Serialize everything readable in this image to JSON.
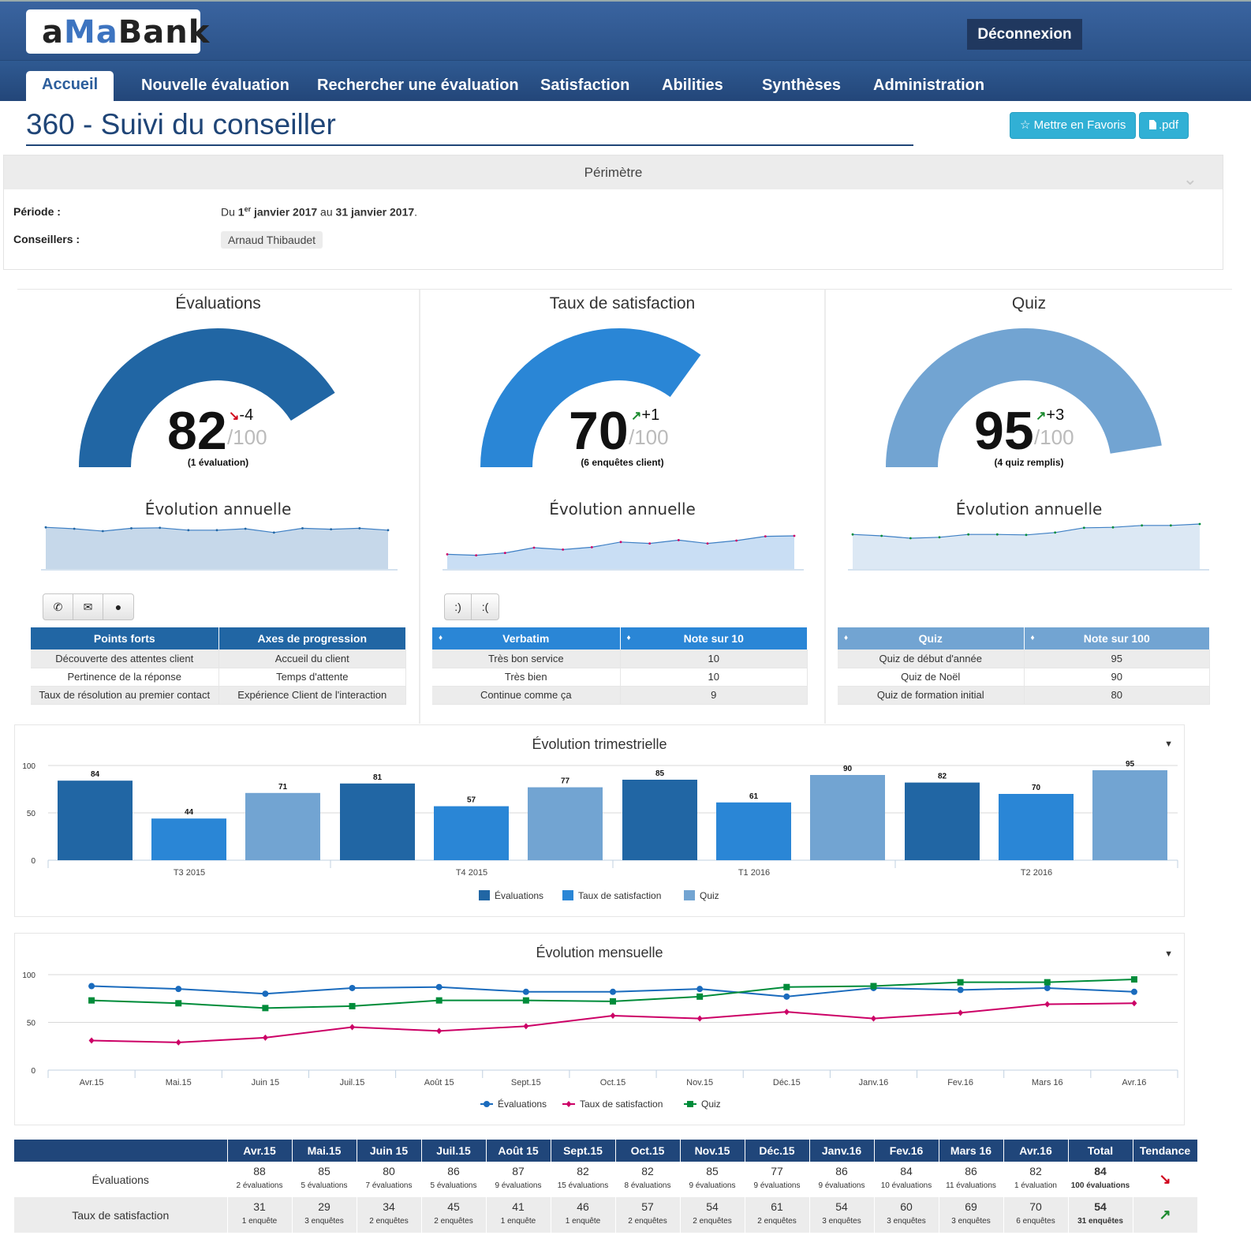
{
  "app": {
    "logo_parts": [
      "a",
      "Ma",
      "Bank"
    ],
    "logout_label": "Déconnexion",
    "brand_colors": {
      "dark": "#2166a4",
      "mid": "#2a86d6",
      "light": "#72a4d2",
      "nav": "#2b5288",
      "pink": "#cc0066",
      "green": "#008c3a"
    }
  },
  "nav": {
    "items": [
      {
        "label": "Accueil",
        "active": true
      },
      {
        "label": "Nouvelle évaluation"
      },
      {
        "label": "Rechercher une évaluation"
      },
      {
        "label": "Satisfaction"
      },
      {
        "label": "Abilities"
      },
      {
        "label": "Synthèses"
      },
      {
        "label": "Administration"
      }
    ]
  },
  "page": {
    "title": "360 - Suivi du conseiller",
    "favorite_label": "Mettre en Favoris",
    "pdf_label": ".pdf",
    "favorite_icon": "star-icon",
    "pdf_icon": "file-icon"
  },
  "perimetre": {
    "title": "Périmètre",
    "periode_label": "Période :",
    "periode_value_parts": [
      "Du ",
      "1",
      "er",
      " janvier 2017",
      " au ",
      "31 janvier 2017",
      "."
    ],
    "conseillers_label": "Conseillers :",
    "conseillers": [
      "Arnaud Thibaudet"
    ]
  },
  "kpis": [
    {
      "title": "Évaluations",
      "value": 82,
      "max": "/100",
      "delta": "-4",
      "trend": "down",
      "count": "(1 évaluation)",
      "color": "#2166a4",
      "annual_title": "Évolution annuelle",
      "annual": [
        88,
        85,
        80,
        86,
        87,
        82,
        82,
        85,
        77,
        86,
        84,
        86,
        82
      ],
      "point_color": "#2166a4",
      "buttons": [
        "phone-icon",
        "envelope-icon",
        "user-icon"
      ],
      "table": {
        "headers": [
          "Points forts",
          "Axes de progression"
        ],
        "sortable": false,
        "rows": [
          [
            "Découverte des attentes client",
            "Accueil du client"
          ],
          [
            "Pertinence de la réponse",
            "Temps d'attente"
          ],
          [
            "Taux de résolution au premier contact",
            "Expérience Client de l'interaction"
          ]
        ]
      }
    },
    {
      "title": "Taux de satisfaction",
      "value": 70,
      "max": "/100",
      "delta": "+1",
      "trend": "up",
      "count": "(6 enquêtes client)",
      "color": "#2a86d6",
      "annual_title": "Évolution annuelle",
      "annual": [
        31,
        29,
        34,
        45,
        41,
        46,
        57,
        54,
        61,
        54,
        60,
        69,
        70
      ],
      "point_color": "#cc0066",
      "buttons": [
        ":)",
        ":("
      ],
      "table": {
        "headers": [
          "Verbatim",
          "Note sur 10"
        ],
        "sortable": true,
        "rows": [
          [
            "Très bon service",
            "10"
          ],
          [
            "Très bien",
            "10"
          ],
          [
            "Continue comme ça",
            "9"
          ]
        ]
      }
    },
    {
      "title": "Quiz",
      "value": 95,
      "max": "/100",
      "delta": "+3",
      "trend": "up",
      "count": "(4 quiz remplis)",
      "color": "#72a4d2",
      "annual_title": "Évolution annuelle",
      "annual": [
        73,
        70,
        65,
        67,
        73,
        73,
        72,
        77,
        87,
        88,
        92,
        92,
        95
      ],
      "point_color": "#008c3a",
      "buttons": [],
      "table": {
        "headers": [
          "Quiz",
          "Note sur 100"
        ],
        "sortable": true,
        "rows": [
          [
            "Quiz de début d'année",
            "95"
          ],
          [
            "Quiz de Noël",
            "90"
          ],
          [
            "Quiz de formation initial",
            "80"
          ]
        ]
      }
    }
  ],
  "chart_data": [
    {
      "type": "bar",
      "title": "Évolution trimestrielle",
      "categories": [
        "T3 2015",
        "T4 2015",
        "T1 2016",
        "T2 2016"
      ],
      "series": [
        {
          "name": "Évaluations",
          "color": "#2166a4",
          "values": [
            84,
            81,
            85,
            82
          ]
        },
        {
          "name": "Taux de satisfaction",
          "color": "#2a86d6",
          "values": [
            44,
            57,
            61,
            70
          ]
        },
        {
          "name": "Quiz",
          "color": "#72a4d2",
          "values": [
            71,
            77,
            90,
            95
          ]
        }
      ],
      "yticks": [
        0,
        50,
        100
      ],
      "ylim": [
        0,
        100
      ],
      "grid": true,
      "legend": "bottom",
      "xlabel": "",
      "ylabel": ""
    },
    {
      "type": "line",
      "title": "Évolution mensuelle",
      "categories": [
        "Avr.15",
        "Mai.15",
        "Juin 15",
        "Juil.15",
        "Août 15",
        "Sept.15",
        "Oct.15",
        "Nov.15",
        "Déc.15",
        "Janv.16",
        "Fev.16",
        "Mars 16",
        "Avr.16"
      ],
      "series": [
        {
          "name": "Évaluations",
          "color": "#1a6bbd",
          "marker": "circle",
          "values": [
            88,
            85,
            80,
            86,
            87,
            82,
            82,
            85,
            77,
            86,
            84,
            86,
            82
          ]
        },
        {
          "name": "Taux de satisfaction",
          "color": "#cc0066",
          "marker": "diamond",
          "values": [
            31,
            29,
            34,
            45,
            41,
            46,
            57,
            54,
            61,
            54,
            60,
            69,
            70
          ]
        },
        {
          "name": "Quiz",
          "color": "#008c3a",
          "marker": "square",
          "values": [
            73,
            70,
            65,
            67,
            73,
            73,
            72,
            77,
            87,
            88,
            92,
            92,
            95
          ]
        }
      ],
      "yticks": [
        0,
        50,
        100
      ],
      "ylim": [
        0,
        100
      ],
      "grid": true,
      "legend": "bottom",
      "xlabel": "",
      "ylabel": ""
    }
  ],
  "summary_table": {
    "headers": [
      "",
      "Avr.15",
      "Mai.15",
      "Juin 15",
      "Juil.15",
      "Août 15",
      "Sept.15",
      "Oct.15",
      "Nov.15",
      "Déc.15",
      "Janv.16",
      "Fev.16",
      "Mars 16",
      "Avr.16",
      "Total",
      "Tendance"
    ],
    "rows": [
      {
        "label": "Évaluations",
        "values": [
          "88",
          "85",
          "80",
          "86",
          "87",
          "82",
          "82",
          "85",
          "77",
          "86",
          "84",
          "86",
          "82",
          "84"
        ],
        "subs": [
          "2 évaluations",
          "5 évaluations",
          "7 évaluations",
          "5 évaluations",
          "9 évaluations",
          "15 évaluations",
          "8 évaluations",
          "9 évaluations",
          "9 évaluations",
          "9 évaluations",
          "10 évaluations",
          "11 évaluations",
          "1 évaluation",
          "100 évaluations"
        ],
        "trend": "down"
      },
      {
        "label": "Taux de satisfaction",
        "values": [
          "31",
          "29",
          "34",
          "45",
          "41",
          "46",
          "57",
          "54",
          "61",
          "54",
          "60",
          "69",
          "70",
          "54"
        ],
        "subs": [
          "1 enquête",
          "3 enquêtes",
          "2 enquêtes",
          "2 enquêtes",
          "1 enquête",
          "1 enquête",
          "2 enquêtes",
          "2 enquêtes",
          "2 enquêtes",
          "3 enquêtes",
          "3 enquêtes",
          "3 enquêtes",
          "6 enquêtes",
          "31 enquêtes"
        ],
        "trend": "up"
      }
    ]
  }
}
